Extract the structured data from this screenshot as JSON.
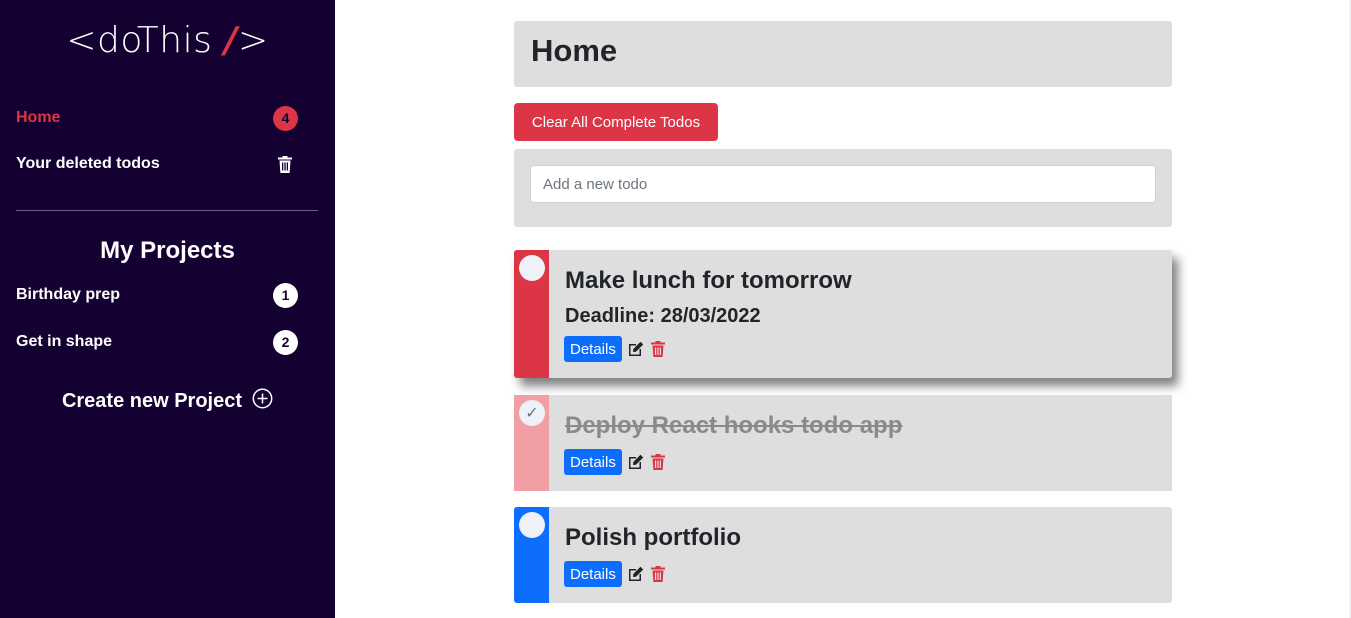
{
  "app": {
    "logo_text": "<doThis ",
    "logo_slash": "/",
    "logo_close": ">"
  },
  "sidebar": {
    "home": {
      "label": "Home",
      "count": "4"
    },
    "deleted": {
      "label": "Your deleted todos",
      "icon": "trash-icon"
    },
    "projects_title": "My Projects",
    "projects": [
      {
        "label": "Birthday prep",
        "count": "1"
      },
      {
        "label": "Get in shape",
        "count": "2"
      }
    ],
    "create_project": {
      "label": "Create new Project",
      "icon": "plus-circle-icon"
    }
  },
  "main": {
    "title": "Home",
    "clear_button": "Clear All Complete Todos",
    "add_input": {
      "placeholder": "Add a new todo",
      "value": ""
    },
    "todos": [
      {
        "title": "Make lunch for tomorrow",
        "deadline": "Deadline: 28/03/2022",
        "completed": false,
        "priority_color": "#dc3545",
        "details_label": "Details"
      },
      {
        "title": "Deploy React hooks todo app",
        "completed": true,
        "priority_color": "#f19ea4",
        "check_mark": "✓",
        "details_label": "Details"
      },
      {
        "title": "Polish portfolio",
        "completed": false,
        "priority_color": "#0d6efd",
        "details_label": "Details"
      }
    ]
  },
  "colors": {
    "sidebar_bg": "#150032",
    "accent_red": "#dc3545",
    "accent_blue": "#0d6efd",
    "card_bg": "#dedede"
  }
}
